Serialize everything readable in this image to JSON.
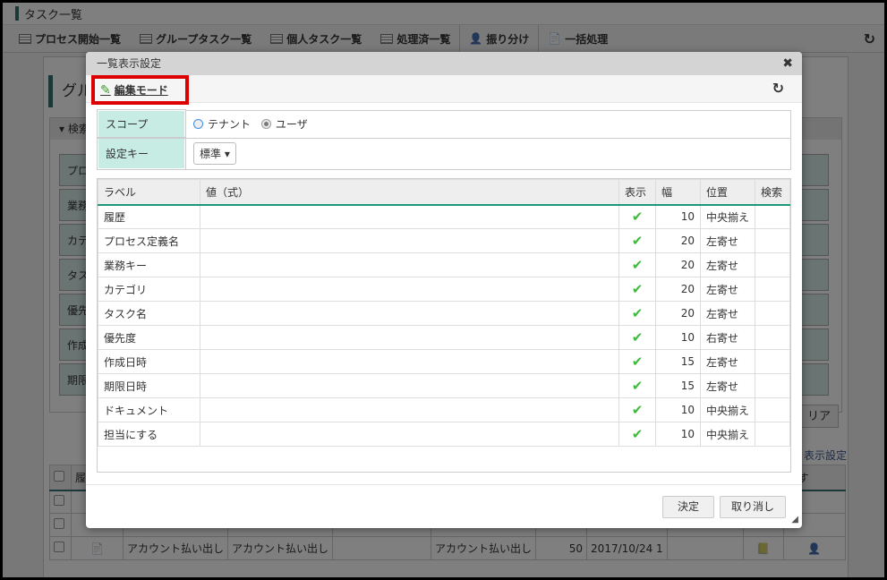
{
  "app": {
    "title": "タスク一覧"
  },
  "toolbar": {
    "items": [
      {
        "label": "プロセス開始一覧",
        "icon": "list-icon"
      },
      {
        "label": "グループタスク一覧",
        "icon": "list-icon"
      },
      {
        "label": "個人タスク一覧",
        "icon": "list-icon"
      },
      {
        "label": "処理済一覧",
        "icon": "list-icon"
      },
      {
        "label": "振り分け",
        "icon": "user-assign-icon"
      },
      {
        "label": "一括処理",
        "icon": "batch-icon"
      }
    ],
    "refresh_icon": "refresh-icon"
  },
  "background": {
    "group_title": "グル",
    "search_header": "検索",
    "search_rows": [
      "プロ",
      "業務",
      "カテ",
      "タス",
      "優先",
      "作成",
      "期限"
    ],
    "clear_button": "リア",
    "display_settings_link": "表示設定",
    "table_header": {
      "col1": "履",
      "last": "にす"
    },
    "table_row": {
      "c1": "アカウント払い出し",
      "c2": "アカウント払い出し",
      "c4": "アカウント払い出し",
      "priority": "50",
      "date": "2017/10/24 1"
    }
  },
  "modal": {
    "title": "一覧表示設定",
    "edit_mode": "編集モード",
    "highlight_color": "#dd0000",
    "scope": {
      "label": "スコープ",
      "options": [
        "テナント",
        "ユーザ"
      ],
      "selected": "ユーザ"
    },
    "setting_key": {
      "label": "設定キー",
      "value": "標準"
    },
    "columns": [
      "ラベル",
      "値（式）",
      "表示",
      "幅",
      "位置",
      "検索"
    ],
    "rows": [
      {
        "label": "履歴",
        "value": "",
        "show": true,
        "width": "10",
        "position": "中央揃え"
      },
      {
        "label": "プロセス定義名",
        "value": "",
        "show": true,
        "width": "20",
        "position": "左寄せ"
      },
      {
        "label": "業務キー",
        "value": "",
        "show": true,
        "width": "20",
        "position": "左寄せ"
      },
      {
        "label": "カテゴリ",
        "value": "",
        "show": true,
        "width": "20",
        "position": "左寄せ"
      },
      {
        "label": "タスク名",
        "value": "",
        "show": true,
        "width": "20",
        "position": "左寄せ"
      },
      {
        "label": "優先度",
        "value": "",
        "show": true,
        "width": "10",
        "position": "右寄せ"
      },
      {
        "label": "作成日時",
        "value": "",
        "show": true,
        "width": "15",
        "position": "左寄せ"
      },
      {
        "label": "期限日時",
        "value": "",
        "show": true,
        "width": "15",
        "position": "左寄せ"
      },
      {
        "label": "ドキュメント",
        "value": "",
        "show": true,
        "width": "10",
        "position": "中央揃え"
      },
      {
        "label": "担当にする",
        "value": "",
        "show": true,
        "width": "10",
        "position": "中央揃え"
      }
    ],
    "ok_button": "決定",
    "cancel_button": "取り消し"
  }
}
